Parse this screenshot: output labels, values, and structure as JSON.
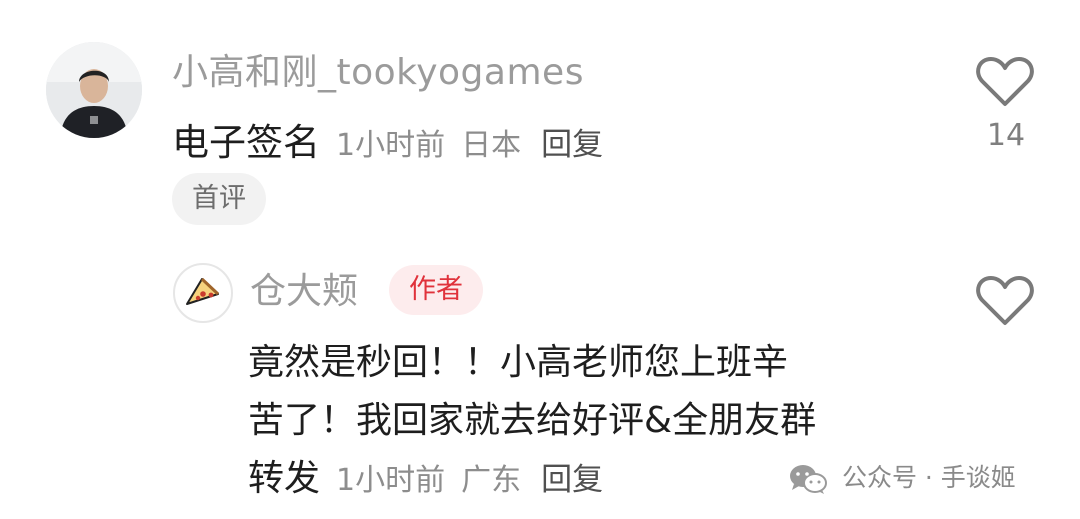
{
  "comment": {
    "username": "小高和刚_tookyogames",
    "text": "电子签名",
    "time": "1小时前",
    "location": "日本",
    "reply_label": "回复",
    "badge": "首评",
    "like_count": "14"
  },
  "reply": {
    "username": "仓大颊",
    "author_badge": "作者",
    "lines": [
      "竟然是秒回！！小高老师您上班辛",
      "苦了！我回家就去给好评&全朋友群",
      "转发"
    ],
    "time": "1小时前",
    "location": "广东",
    "reply_label": "回复"
  },
  "watermark": {
    "text": "公众号 · 手谈姬",
    "icon": "wechat-icon"
  },
  "icons": {
    "like": "heart-outline-icon"
  },
  "colors": {
    "author_badge_text": "#e0323b",
    "author_badge_bg": "#fdeced",
    "username": "#9b9b9b"
  }
}
